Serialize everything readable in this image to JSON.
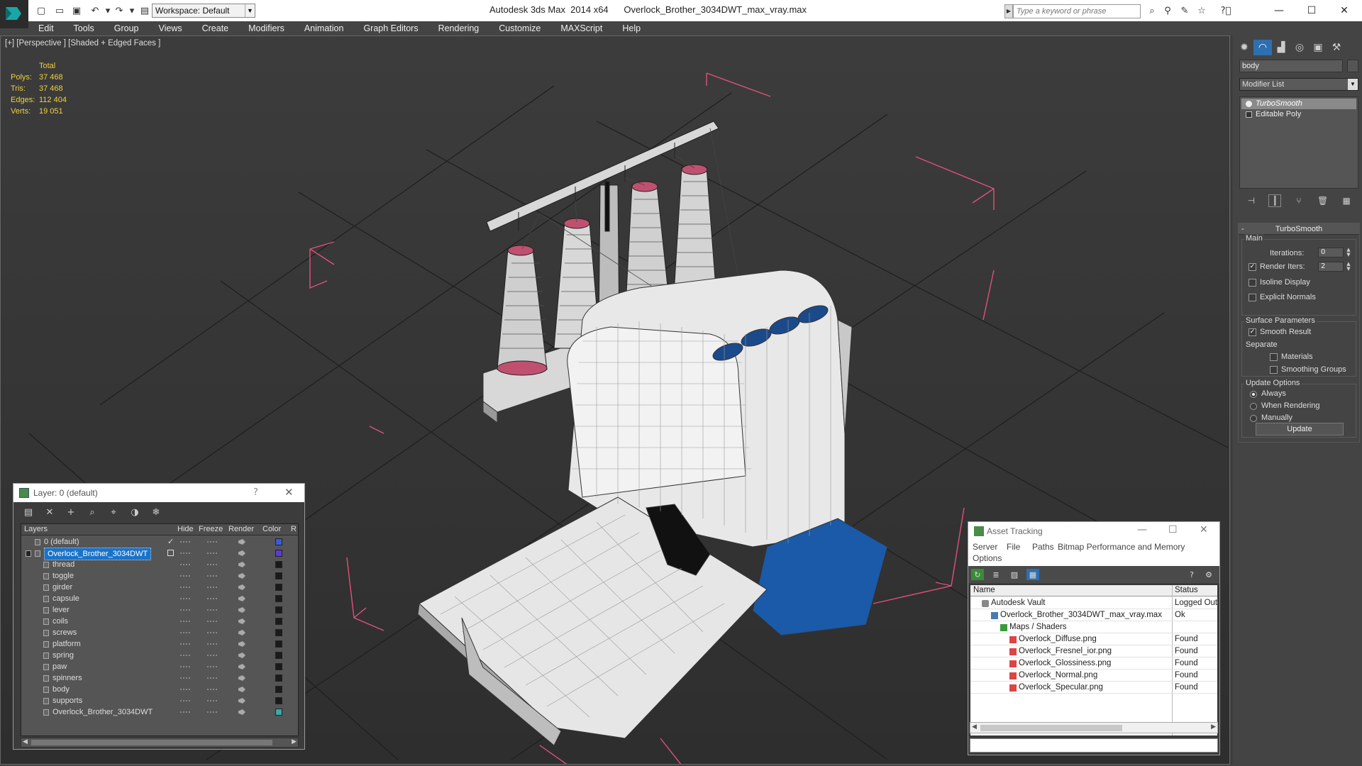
{
  "app": {
    "title": "Autodesk 3ds Max  2014 x64      Overlock_Brother_3034DWT_max_vray.max",
    "workspace": "Workspace: Default",
    "search_placeholder": "Type a keyword or phrase"
  },
  "menu": [
    "Edit",
    "Tools",
    "Group",
    "Views",
    "Create",
    "Modifiers",
    "Animation",
    "Graph Editors",
    "Rendering",
    "Customize",
    "MAXScript",
    "Help"
  ],
  "viewport": {
    "label": "[+] [Perspective ] [Shaded + Edged Faces ]",
    "stats": {
      "header": "Total",
      "rows": [
        {
          "k": "Polys:",
          "v": "37 468"
        },
        {
          "k": "Tris:",
          "v": "37 468"
        },
        {
          "k": "Edges:",
          "v": "112 404"
        },
        {
          "k": "Verts:",
          "v": "19 051"
        }
      ]
    }
  },
  "command_panel": {
    "object_name": "body",
    "modifier_list": "Modifier List",
    "stack": [
      "TurboSmooth",
      "Editable Poly"
    ],
    "rollout_title": "TurboSmooth",
    "main_group": "Main",
    "iterations_label": "Iterations:",
    "iterations_value": "0",
    "render_iters_label": "Render Iters:",
    "render_iters_value": "2",
    "isoline": "Isoline Display",
    "explicit_normals": "Explicit Normals",
    "surface_group": "Surface Parameters",
    "smooth_result": "Smooth Result",
    "separate": "Separate",
    "materials": "Materials",
    "smoothing_groups": "Smoothing Groups",
    "update_group": "Update Options",
    "always": "Always",
    "when_rendering": "When Rendering",
    "manually": "Manually",
    "update_button": "Update"
  },
  "layer_panel": {
    "title": "Layer: 0 (default)",
    "help": "?",
    "columns": [
      "Layers",
      "Hide",
      "Freeze",
      "Render",
      "Color",
      "R"
    ],
    "layers": [
      {
        "name": "0 (default)",
        "color": "#3a5bd8"
      },
      {
        "name": "Overlock_Brother_3034DWT",
        "color": "#5a3ad8"
      },
      {
        "name": "thread",
        "color": "#1a1a1a"
      },
      {
        "name": "toggle",
        "color": "#1a1a1a"
      },
      {
        "name": "girder",
        "color": "#1a1a1a"
      },
      {
        "name": "capsule",
        "color": "#1a1a1a"
      },
      {
        "name": "lever",
        "color": "#1a1a1a"
      },
      {
        "name": "coils",
        "color": "#1a1a1a"
      },
      {
        "name": "screws",
        "color": "#1a1a1a"
      },
      {
        "name": "platform",
        "color": "#1a1a1a"
      },
      {
        "name": "spring",
        "color": "#1a1a1a"
      },
      {
        "name": "paw",
        "color": "#1a1a1a"
      },
      {
        "name": "spinners",
        "color": "#1a1a1a"
      },
      {
        "name": "body",
        "color": "#1a1a1a"
      },
      {
        "name": "supports",
        "color": "#1a1a1a"
      },
      {
        "name": "Overlock_Brother_3034DWT",
        "color": "#3aa8a8"
      }
    ]
  },
  "asset_panel": {
    "title": "Asset Tracking",
    "menu": [
      "Server",
      "File",
      "Paths",
      "Bitmap Performance and Memory",
      "Options"
    ],
    "columns": [
      "Name",
      "Status"
    ],
    "rows": [
      {
        "name": "Autodesk Vault",
        "status": "Logged Out",
        "indent": 0
      },
      {
        "name": "Overlock_Brother_3034DWT_max_vray.max",
        "status": "Ok",
        "indent": 1
      },
      {
        "name": "Maps / Shaders",
        "status": "",
        "indent": 2
      },
      {
        "name": "Overlock_Diffuse.png",
        "status": "Found",
        "indent": 3
      },
      {
        "name": "Overlock_Fresnel_ior.png",
        "status": "Found",
        "indent": 3
      },
      {
        "name": "Overlock_Glossiness.png",
        "status": "Found",
        "indent": 3
      },
      {
        "name": "Overlock_Normal.png",
        "status": "Found",
        "indent": 3
      },
      {
        "name": "Overlock_Specular.png",
        "status": "Found",
        "indent": 3
      }
    ]
  },
  "colors": {
    "accent_select": "#1a73c8",
    "stats_yellow": "#f0d040",
    "bbox_pink": "#e0507a",
    "machine_blue": "#1a5aa8"
  }
}
